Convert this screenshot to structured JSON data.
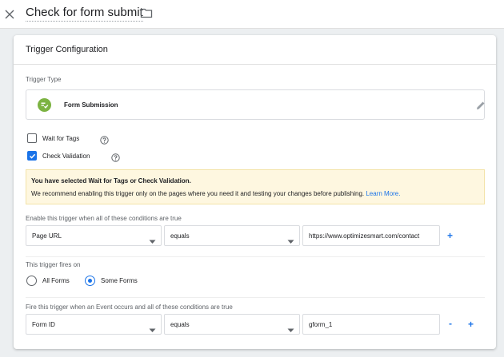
{
  "header": {
    "title": "Check for form submit",
    "close_icon": "close-icon",
    "folder_icon": "folder-icon"
  },
  "card": {
    "title": "Trigger Configuration"
  },
  "trigger_type": {
    "label": "Trigger Type",
    "name": "Form Submission",
    "icon": "form-submission-icon",
    "icon_color": "#7cb342"
  },
  "options": {
    "wait_for_tags": {
      "label": "Wait for Tags",
      "checked": false
    },
    "check_validation": {
      "label": "Check Validation",
      "checked": true
    }
  },
  "notice": {
    "title": "You have selected Wait for Tags or Check Validation.",
    "body": "We recommend enabling this trigger only on the pages where you need it and testing your changes before publishing. ",
    "link": "Learn More."
  },
  "enable_conditions": {
    "label": "Enable this trigger when all of these conditions are true",
    "variable": "Page URL",
    "operator": "equals",
    "value": "https://www.optimizesmart.com/contact",
    "add_label": "+"
  },
  "fires_on": {
    "label": "This trigger fires on",
    "options": [
      {
        "label": "All Forms",
        "selected": false
      },
      {
        "label": "Some Forms",
        "selected": true
      }
    ]
  },
  "fire_conditions": {
    "label": "Fire this trigger when an Event occurs and all of these conditions are true",
    "variable": "Form ID",
    "operator": "equals",
    "value": "gform_1",
    "remove_label": "-",
    "add_label": "+"
  },
  "colors": {
    "accent": "#1a73e8",
    "notice_bg": "#fef7e0"
  }
}
